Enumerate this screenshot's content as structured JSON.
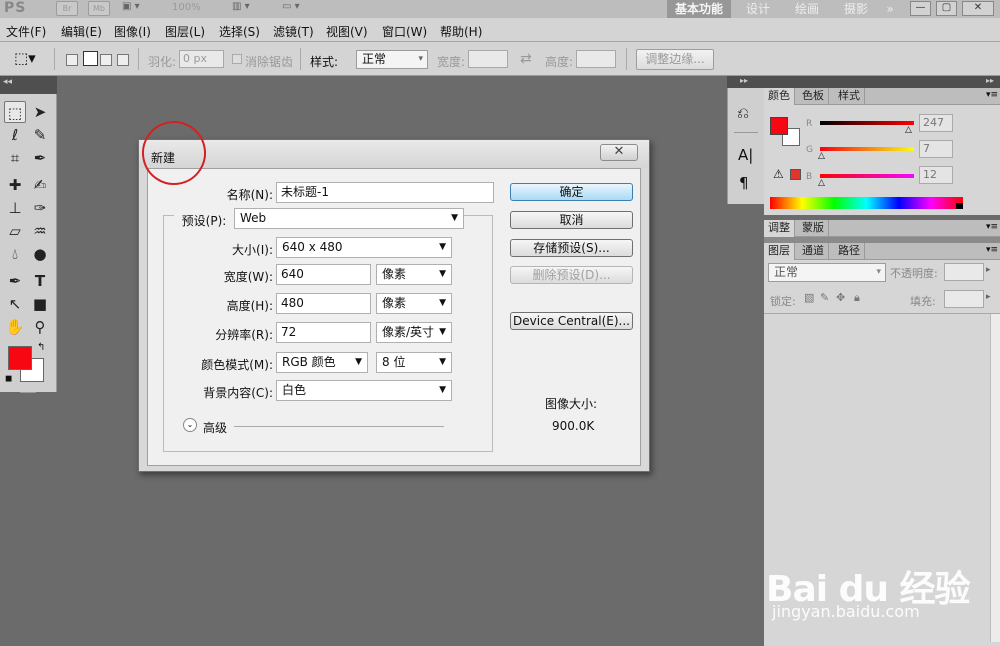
{
  "app": {
    "logo": "PS",
    "zoom": "100%",
    "workspaces": [
      "基本功能",
      "设计",
      "绘画",
      "摄影"
    ],
    "more": "»"
  },
  "menu": [
    "文件(F)",
    "编辑(E)",
    "图像(I)",
    "图层(L)",
    "选择(S)",
    "滤镜(T)",
    "视图(V)",
    "窗口(W)",
    "帮助(H)"
  ],
  "options": {
    "feather_label": "羽化:",
    "feather_value": "0 px",
    "antialias_label": "消除锯齿",
    "style_label": "样式:",
    "style_value": "正常",
    "width_label": "宽度:",
    "height_label": "高度:",
    "refine_button": "调整边缘..."
  },
  "dialog": {
    "title": "新建",
    "name_label": "名称(N):",
    "name_value": "未标题-1",
    "preset_label": "预设(P):",
    "preset_value": "Web",
    "size_label": "大小(I):",
    "size_value": "640 x 480",
    "width_label": "宽度(W):",
    "width_value": "640",
    "width_unit": "像素",
    "height_label": "高度(H):",
    "height_value": "480",
    "height_unit": "像素",
    "resolution_label": "分辨率(R):",
    "resolution_value": "72",
    "resolution_unit": "像素/英寸",
    "colormode_label": "颜色模式(M):",
    "colormode_value": "RGB 颜色",
    "bitdepth_value": "8 位",
    "background_label": "背景内容(C):",
    "background_value": "白色",
    "advanced_label": "高级",
    "ok_button": "确定",
    "cancel_button": "取消",
    "save_preset_button": "存储预设(S)...",
    "delete_preset_button": "删除预设(D)...",
    "device_central_button": "Device Central(E)...",
    "image_size_label": "图像大小:",
    "image_size_value": "900.0K"
  },
  "panels": {
    "color_tabs": [
      "颜色",
      "色板",
      "样式"
    ],
    "r_label": "R",
    "r_value": "247",
    "g_label": "G",
    "g_value": "7",
    "b_label": "B",
    "b_value": "12",
    "adjust_tabs": [
      "调整",
      "蒙版"
    ],
    "layers_tabs": [
      "图层",
      "通道",
      "路径"
    ],
    "blend_value": "正常",
    "opacity_label": "不透明度:",
    "lock_label": "锁定:",
    "fill_label": "填充:"
  },
  "watermark": {
    "text": "Bai du 经验",
    "url": "jingyan.baidu.com"
  },
  "colors": {
    "foreground": "#f70712",
    "background": "#ffffff",
    "accent_primary": "#a9daf5"
  }
}
